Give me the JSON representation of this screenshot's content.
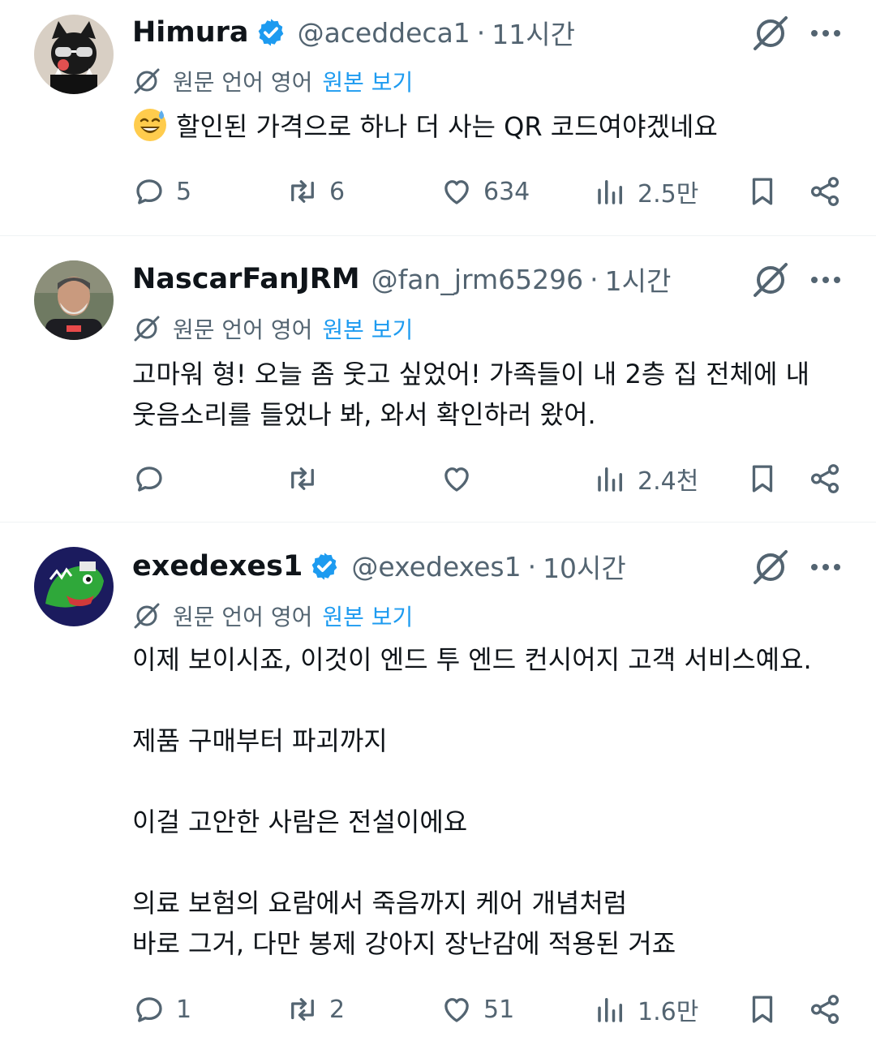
{
  "ui": {
    "translate_label": "원문 언어 영어",
    "translate_link": "원본 보기",
    "dot": "·"
  },
  "colors": {
    "text": "#0f1419",
    "muted": "#536471",
    "link": "#1d9bf0",
    "verified": "#1d9bf0",
    "divider": "#eff3f4"
  },
  "tweets": [
    {
      "name": "Himura",
      "verified": true,
      "handle": "@aceddeca1",
      "time": "11시간",
      "emoji": "sweat-smile-emoji",
      "body": [
        "할인된 가격으로 하나 더 사는 QR 코드여야겠네요"
      ],
      "replies": "5",
      "reposts": "6",
      "likes": "634",
      "views": "2.5만"
    },
    {
      "name": "NascarFanJRM",
      "verified": false,
      "handle": "@fan_jrm65296",
      "time": "1시간",
      "body": [
        "고마워 형! 오늘 좀 웃고 싶었어! 가족들이 내 2층 집 전체에 내",
        "웃음소리를 들었나 봐, 와서 확인하러 왔어."
      ],
      "replies": "",
      "reposts": "",
      "likes": "",
      "views": "2.4천"
    },
    {
      "name": "exedexes1",
      "verified": true,
      "handle": "@exedexes1",
      "time": "10시간",
      "body": [
        "이제 보이시죠, 이것이 엔드 투 엔드 컨시어지 고객 서비스예요.",
        "",
        "제품 구매부터 파괴까지",
        "",
        "이걸 고안한 사람은 전설이에요",
        "",
        "의료 보험의 요람에서 죽음까지 케어 개념처럼",
        "바로 그거, 다만 봉제 강아지 장난감에 적용된 거죠"
      ],
      "replies": "1",
      "reposts": "2",
      "likes": "51",
      "views": "1.6만"
    }
  ]
}
